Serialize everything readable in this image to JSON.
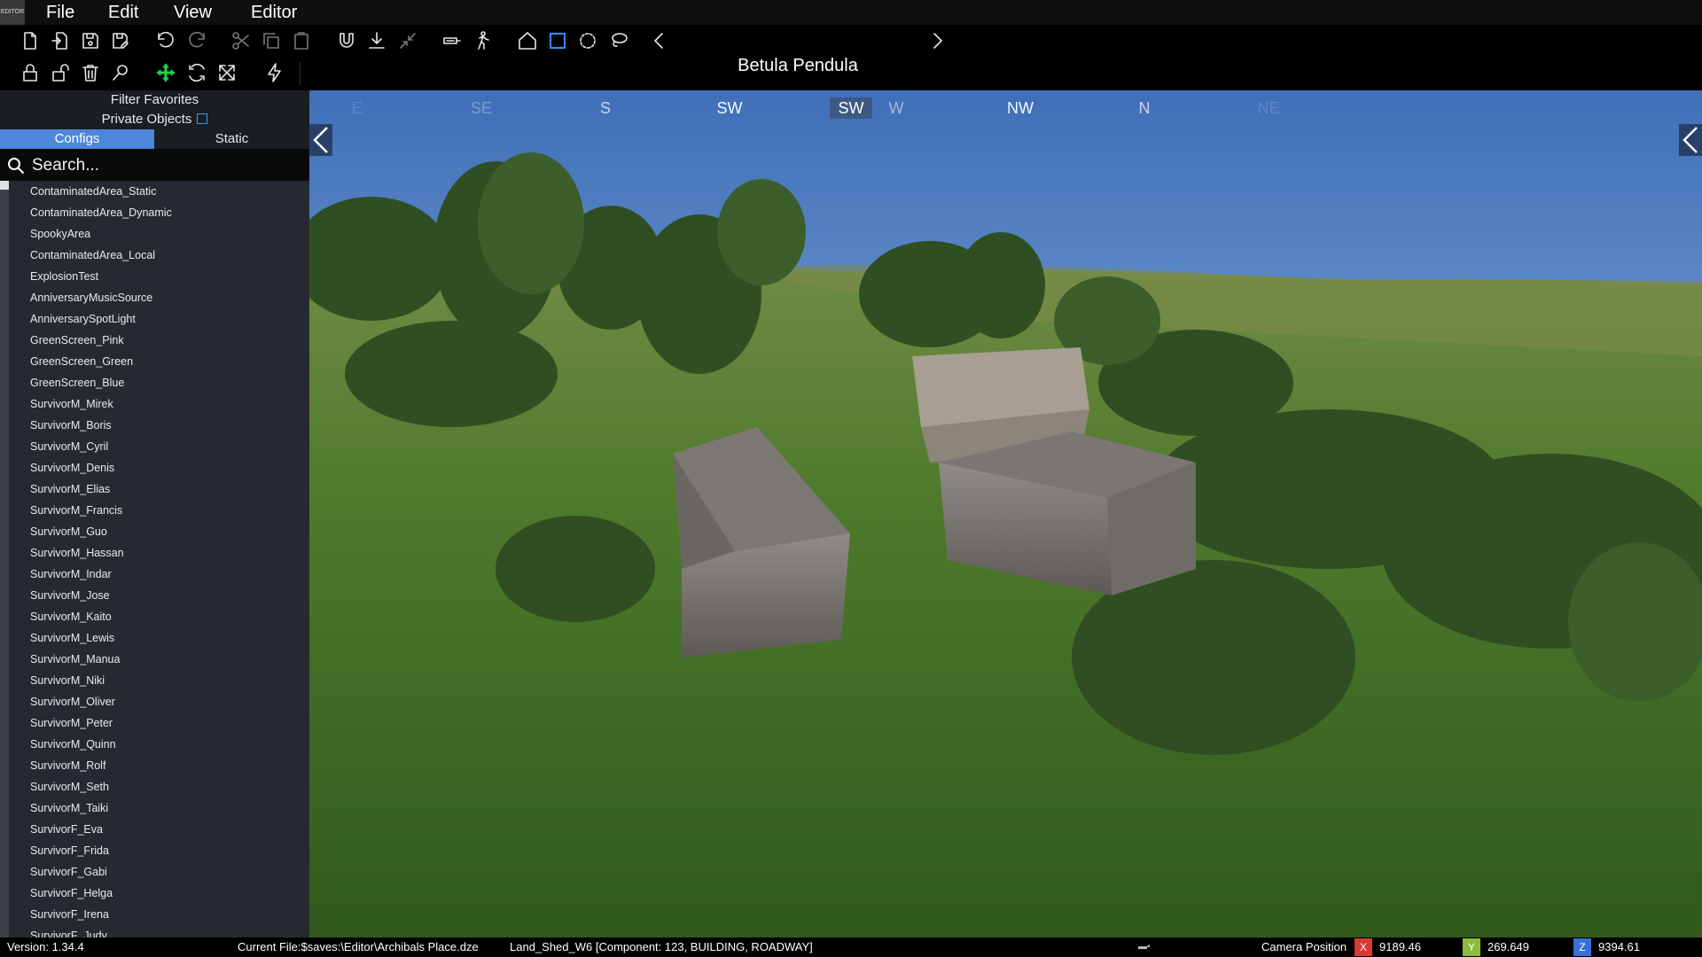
{
  "menu": {
    "file": "File",
    "edit": "Edit",
    "view": "View",
    "editor": "Editor"
  },
  "app_logo_text": "EDITOR",
  "object_title": "Betula Pendula",
  "sidebar": {
    "filter_favorites": "Filter Favorites",
    "private_objects": "Private Objects",
    "tabs": {
      "configs": "Configs",
      "static": "Static"
    },
    "search_placeholder": "Search...",
    "items": [
      "ContaminatedArea_Static",
      "ContaminatedArea_Dynamic",
      "SpookyArea",
      "ContaminatedArea_Local",
      "ExplosionTest",
      "AnniversaryMusicSource",
      "AnniversarySpotLight",
      "GreenScreen_Pink",
      "GreenScreen_Green",
      "GreenScreen_Blue",
      "SurvivorM_Mirek",
      "SurvivorM_Boris",
      "SurvivorM_Cyril",
      "SurvivorM_Denis",
      "SurvivorM_Elias",
      "SurvivorM_Francis",
      "SurvivorM_Guo",
      "SurvivorM_Hassan",
      "SurvivorM_Indar",
      "SurvivorM_Jose",
      "SurvivorM_Kaito",
      "SurvivorM_Lewis",
      "SurvivorM_Manua",
      "SurvivorM_Niki",
      "SurvivorM_Oliver",
      "SurvivorM_Peter",
      "SurvivorM_Quinn",
      "SurvivorM_Rolf",
      "SurvivorM_Seth",
      "SurvivorM_Taiki",
      "SurvivorF_Eva",
      "SurvivorF_Frida",
      "SurvivorF_Gabi",
      "SurvivorF_Helga",
      "SurvivorF_Irena",
      "SurvivorF_Judy"
    ]
  },
  "compass": {
    "labels": [
      "E",
      "SE",
      "S",
      "SW",
      "SW",
      "W",
      "NW",
      "N",
      "NE"
    ],
    "active": "SW"
  },
  "status": {
    "version": "Version:  1.34.4",
    "current_file": "Current File:$saves:\\Editor\\Archibals Place.dze",
    "selected_object": "Land_Shed_W6 [Component: 123, BUILDING, ROADWAY]",
    "camera_label": "Camera Position",
    "x_label": "X",
    "x_value": "9189.46",
    "y_label": "Y",
    "y_value": "269.649",
    "z_label": "Z",
    "z_value": "9394.61"
  },
  "colors": {
    "tab_active": "#4e86de",
    "x_badge": "#d83a32",
    "y_badge": "#8dbb3a",
    "z_badge": "#3a6fd8",
    "move_tool": "#1fd14a"
  }
}
